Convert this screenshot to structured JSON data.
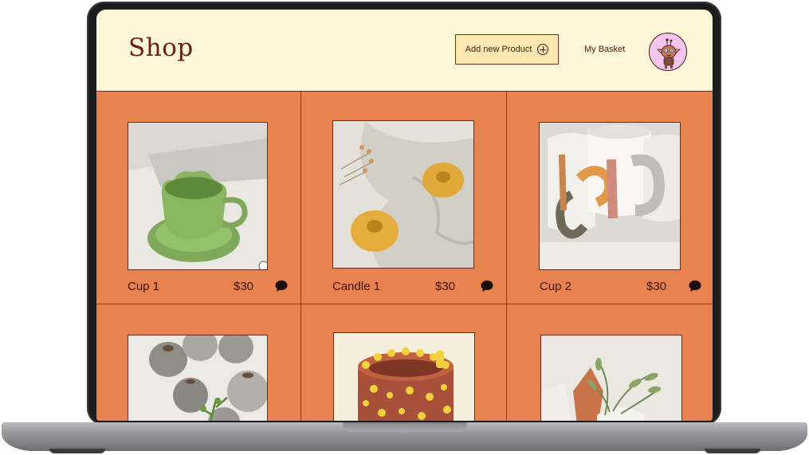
{
  "header": {
    "logo": "Shop",
    "add_product_label": "Add new Product",
    "basket_label": "My Basket"
  },
  "products": [
    {
      "name": "Cup 1",
      "price": "$30"
    },
    {
      "name": "Candle 1",
      "price": "$30"
    },
    {
      "name": "Cup 2",
      "price": "$30"
    }
  ],
  "icons": {
    "add": "plus-circle-icon",
    "comment": "speech-bubble-icon",
    "avatar": "cartoon-creature-avatar"
  },
  "colors": {
    "header_bg": "#fdf6d7",
    "grid_bg": "#e8834f",
    "accent_dark": "#6a1e1e",
    "button_bg": "#fbe7b0",
    "avatar_bg": "#f4c6ee"
  }
}
